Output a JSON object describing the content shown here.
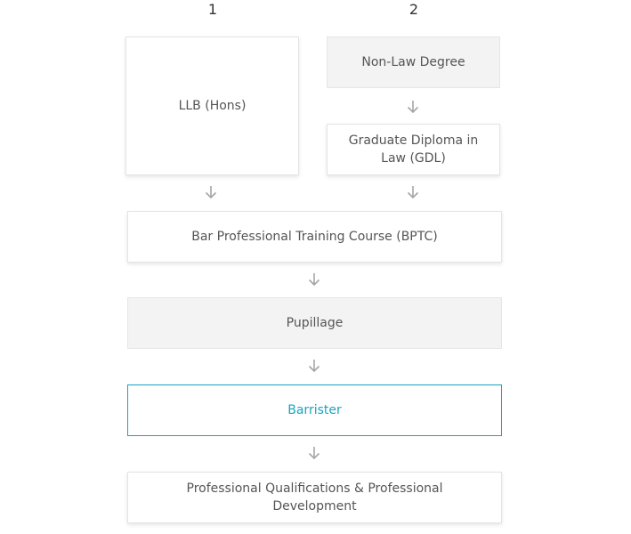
{
  "routes": {
    "route_1_number": "1",
    "route_2_number": "2"
  },
  "boxes": {
    "llb": "LLB (Hons)",
    "non_law_degree": "Non-Law Degree",
    "gdl": "Graduate Diploma in Law (GDL)",
    "bptc": "Bar Professional Training Course (BPTC)",
    "pupillage": "Pupillage",
    "barrister": "Barrister",
    "professional_development": "Professional Qualifications & Professional Development"
  },
  "colors": {
    "accent": "#1aa3c2",
    "grey_box": "#f3f3f3",
    "arrow": "#a6a6a6"
  },
  "icons": {
    "arrow": "arrow-down-icon"
  }
}
